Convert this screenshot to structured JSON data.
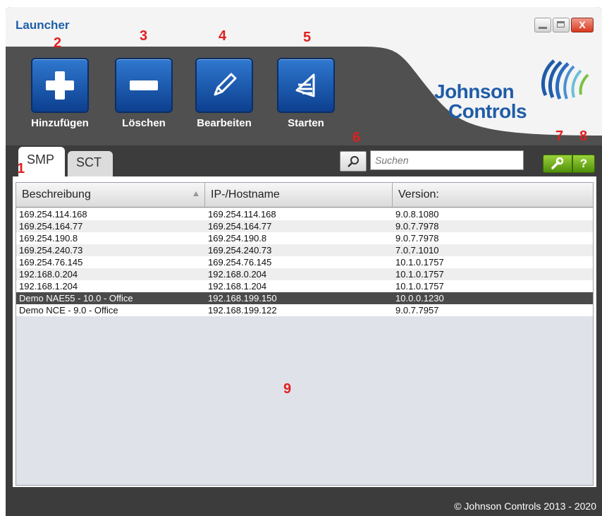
{
  "window": {
    "title": "Launcher",
    "close_label": "X"
  },
  "toolbar": {
    "add_label": "Hinzufügen",
    "delete_label": "Löschen",
    "edit_label": "Bearbeiten",
    "start_label": "Starten"
  },
  "brand": {
    "line1": "Johnson",
    "line2": "Controls",
    "blue": "#1f5ca8",
    "green": "#7ac143"
  },
  "annotations": {
    "n1": "1",
    "n2": "2",
    "n3": "3",
    "n4": "4",
    "n5": "5",
    "n6": "6",
    "n7": "7",
    "n8": "8",
    "n9": "9",
    "color": "#e02020"
  },
  "tabs": [
    {
      "label": "SMP",
      "active": true
    },
    {
      "label": "SCT",
      "active": false
    }
  ],
  "search": {
    "placeholder": "Suchen",
    "icon": "search-icon"
  },
  "tools": {
    "settings_icon": "wrench-icon",
    "help_label": "?"
  },
  "table": {
    "columns": [
      "Beschreibung",
      "IP-/Hostname",
      "Version:"
    ],
    "rows": [
      [
        "169.254.114.168",
        "169.254.114.168",
        "9.0.8.1080"
      ],
      [
        "169.254.164.77",
        "169.254.164.77",
        "9.0.7.7978"
      ],
      [
        "169.254.190.8",
        "169.254.190.8",
        "9.0.7.7978"
      ],
      [
        "169.254.240.73",
        "169.254.240.73",
        "7.0.7.1010"
      ],
      [
        "169.254.76.145",
        "169.254.76.145",
        "10.1.0.1757"
      ],
      [
        "192.168.0.204",
        "192.168.0.204",
        "10.1.0.1757"
      ],
      [
        "192.168.1.204",
        "192.168.1.204",
        "10.1.0.1757"
      ],
      [
        "Demo NAE55 - 10.0 - Office",
        "192.168.199.150",
        "10.0.0.1230"
      ],
      [
        "Demo NCE - 9.0 - Office",
        "192.168.199.122",
        "9.0.7.7957"
      ]
    ],
    "selected_row": 7
  },
  "footer": {
    "copyright": "© Johnson Controls 2013 - 2020"
  }
}
